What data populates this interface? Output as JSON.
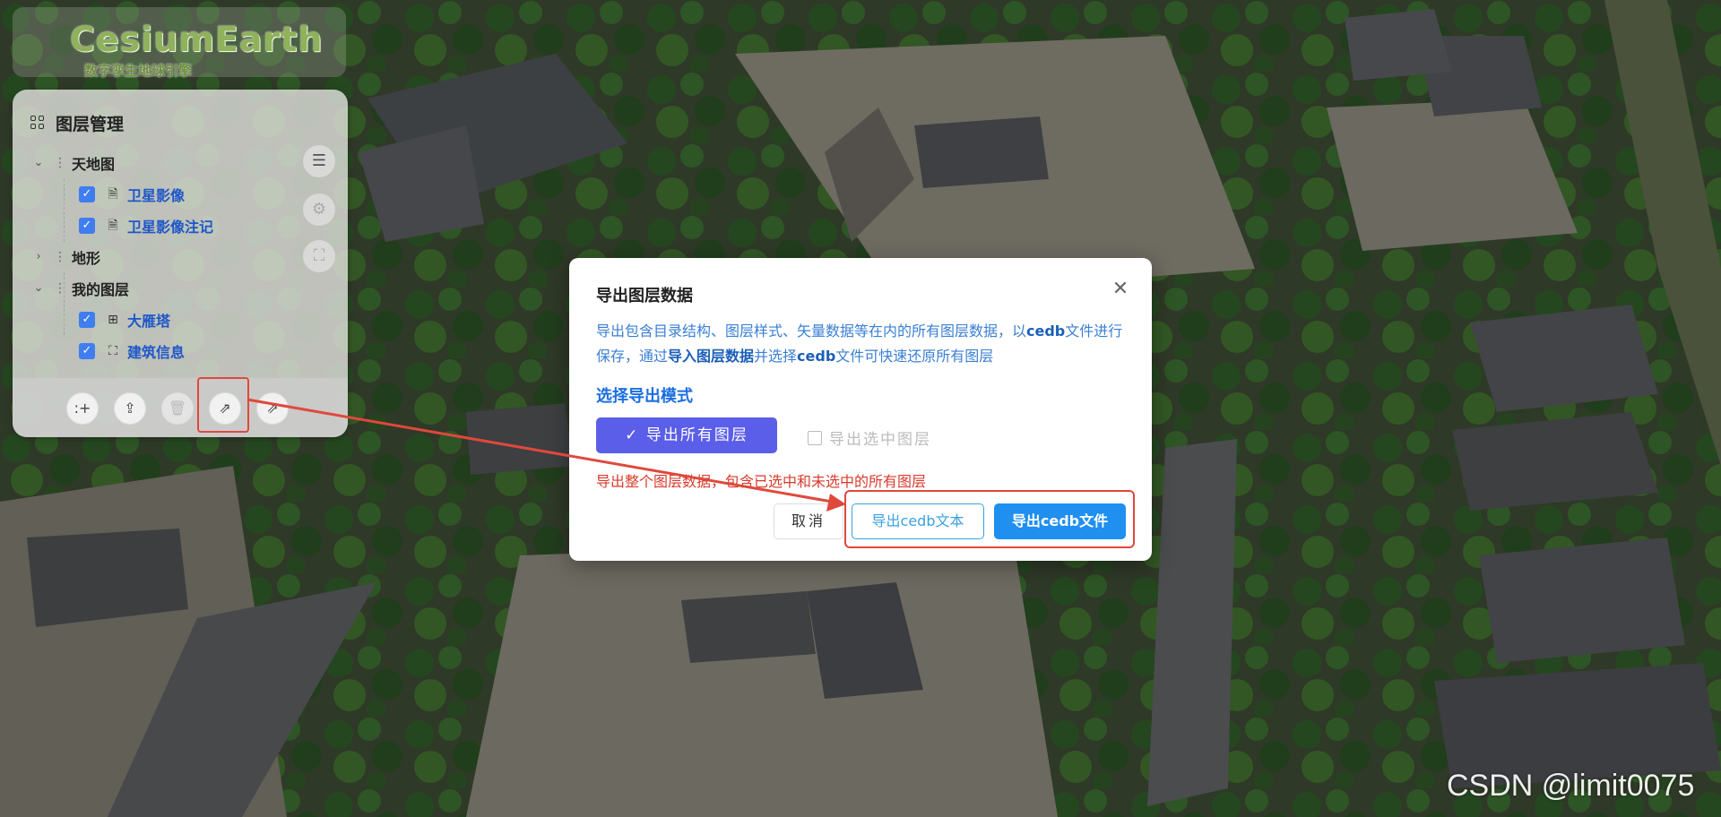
{
  "logo": {
    "title": "CesiumEarth",
    "subtitle": "数字孪生地球引擎"
  },
  "panel": {
    "title": "图层管理",
    "groups": [
      {
        "label": "天地图",
        "expanded": true,
        "layers": [
          {
            "name": "卫星影像",
            "checked": true
          },
          {
            "name": "卫星影像注记",
            "checked": true
          }
        ]
      },
      {
        "label": "地形",
        "expanded": false,
        "layers": []
      },
      {
        "label": "我的图层",
        "expanded": true,
        "layers": [
          {
            "name": "大雁塔",
            "checked": true
          },
          {
            "name": "建筑信息",
            "checked": true
          }
        ]
      }
    ],
    "side_buttons": [
      "list-indent-icon",
      "settings-icon",
      "fullscreen-icon"
    ],
    "footer_buttons": [
      "add-icon",
      "import-icon",
      "delete-icon",
      "export-icon",
      "export-icon"
    ]
  },
  "dialog": {
    "title": "导出图层数据",
    "desc_part1": "导出包含目录结构、图层样式、矢量数据等在内的所有图层数据，以",
    "desc_b1": "cedb",
    "desc_part2": "文件进行保存，通过",
    "desc_b2": "导入图层数据",
    "desc_part3": "并选择",
    "desc_b3": "cedb",
    "desc_part4": "文件可快速还原所有图层",
    "section_title": "选择导出模式",
    "mode_all": "导出所有图层",
    "mode_selected": "导出选中图层",
    "hint": "导出整个图层数据，包含已选中和未选中的所有图层",
    "cancel": "取消",
    "export_text": "导出cedb文本",
    "export_file": "导出cedb文件"
  },
  "watermark": "CSDN @limit0075",
  "colors": {
    "accent": "#1f8ff0",
    "mode_button": "#5b5ee8",
    "hint_red": "#d93a2b",
    "highlight_red": "#e0483c"
  }
}
